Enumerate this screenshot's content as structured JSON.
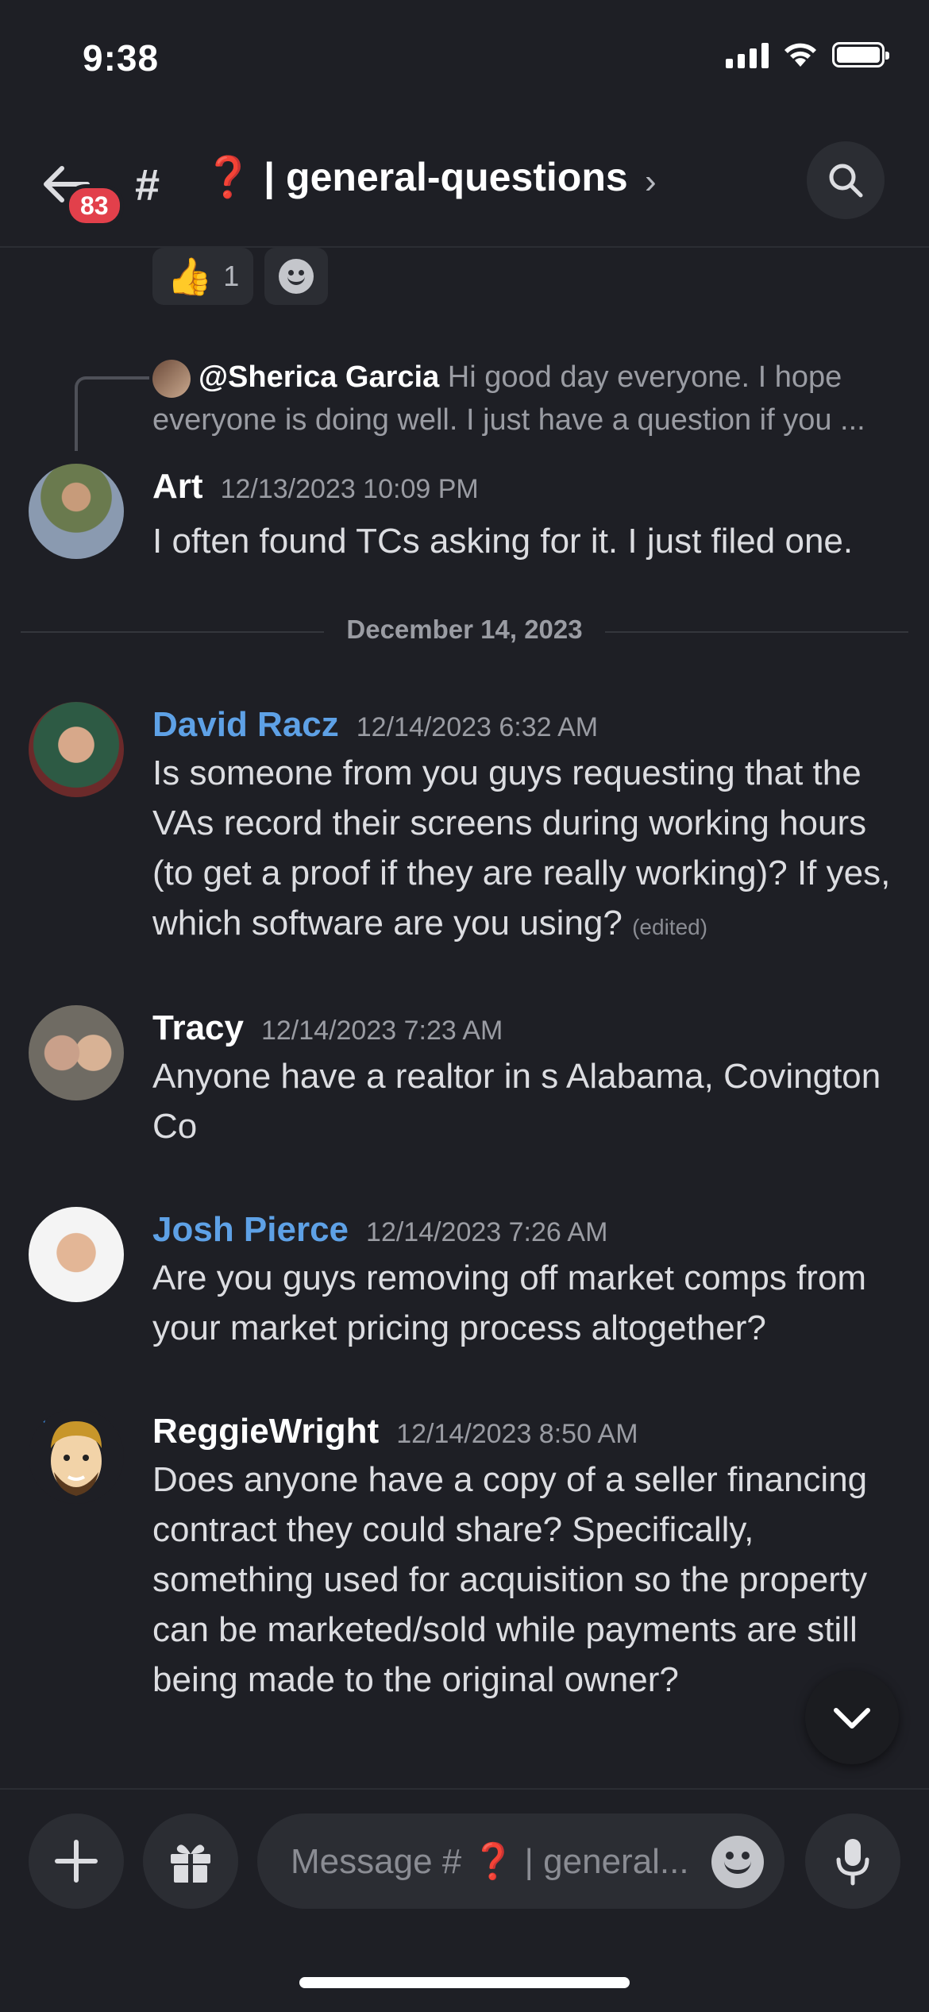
{
  "status_bar": {
    "time": "9:38"
  },
  "header": {
    "badge_count": "83",
    "channel_icon": "#",
    "channel_emoji": "❓",
    "channel_name": "| general-questions",
    "chevron": "›"
  },
  "reactions": [
    {
      "emoji": "👍",
      "count": "1"
    }
  ],
  "reply_preview": {
    "author": "@Sherica Garcia",
    "text": "Hi good day everyone. I hope everyone is doing well. I just have a question if you ..."
  },
  "messages": [
    {
      "author": "Art",
      "timestamp": "12/13/2023 10:09 PM",
      "text": "I often found TCs asking for it. I just filed one."
    },
    {
      "author": "David Racz",
      "timestamp": "12/14/2023 6:32 AM",
      "text": "Is someone from you guys requesting that the VAs record their screens during working hours (to get a proof if they are really working)? If yes, which software are you using?",
      "edited": "(edited)"
    },
    {
      "author": "Tracy",
      "timestamp": "12/14/2023 7:23 AM",
      "text": "Anyone have a realtor in s Alabama, Covington Co"
    },
    {
      "author": "Josh Pierce",
      "timestamp": "12/14/2023 7:26 AM",
      "text": "Are you guys removing off market comps from your market pricing process altogether?"
    },
    {
      "author": "ReggieWright",
      "timestamp": "12/14/2023 8:50 AM",
      "text": "Does anyone have a copy of a seller financing contract they could share? Specifically, something used for acquisition so the property can be marketed/sold while payments are still being made to the original owner?"
    }
  ],
  "date_divider": "December 14, 2023",
  "composer": {
    "placeholder_prefix": "Message #",
    "placeholder_emoji": "❓",
    "placeholder_suffix": "| general..."
  }
}
